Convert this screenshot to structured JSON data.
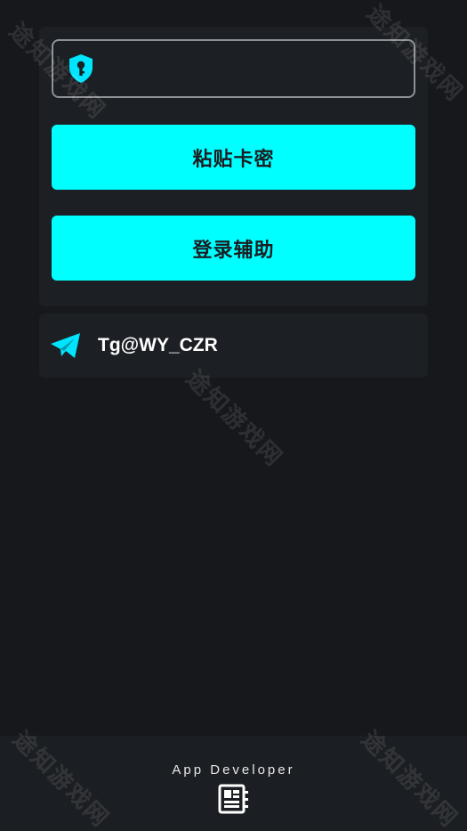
{
  "login": {
    "key_input": {
      "value": "",
      "placeholder": ""
    },
    "paste_label": "粘贴卡密",
    "login_label": "登录辅助"
  },
  "contact": {
    "label": "Tg@WY_CZR",
    "icon": "telegram-icon"
  },
  "footer": {
    "label": "App Developer",
    "icon": "developer-icon"
  },
  "watermark": "途知游戏网",
  "colors": {
    "accent": "#00ffff",
    "background": "#16181b",
    "card": "#1c1f23",
    "text": "#ffffff"
  }
}
